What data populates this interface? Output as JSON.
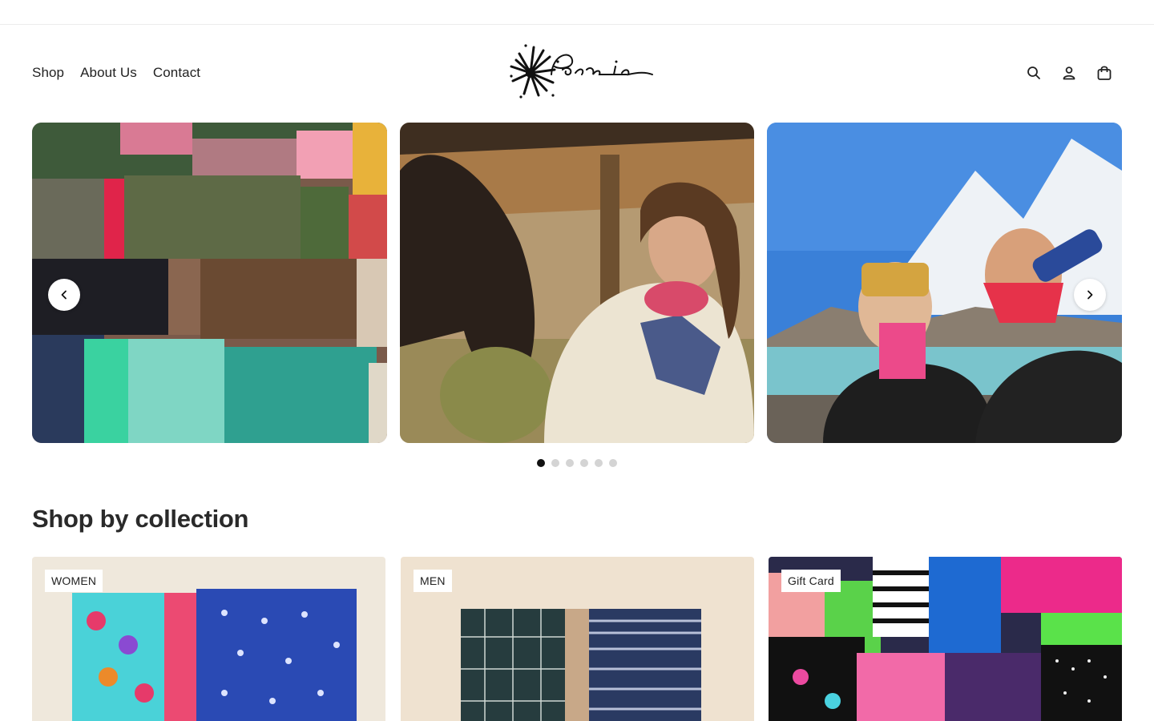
{
  "nav": {
    "items": [
      {
        "label": "Shop"
      },
      {
        "label": "About Us"
      },
      {
        "label": "Contact"
      }
    ]
  },
  "logo": {
    "text": "Peace is",
    "icon": "sunburst-logo"
  },
  "header_icons": [
    "search-icon",
    "account-icon",
    "cart-icon"
  ],
  "slider": {
    "slides": [
      {
        "description_icon": "fabric-stack-image"
      },
      {
        "description_icon": "woman-with-mule-image"
      },
      {
        "description_icon": "mountain-selfie-image"
      }
    ],
    "dots": {
      "count": 6,
      "active": 0
    }
  },
  "collections": {
    "title": "Shop by collection",
    "cards": [
      {
        "label": "WOMEN"
      },
      {
        "label": "MEN"
      },
      {
        "label": "Gift Card"
      }
    ]
  },
  "colors": {
    "text": "#1f1f1f",
    "dot_active": "#111111",
    "dot_inactive": "#d4d4d4"
  }
}
